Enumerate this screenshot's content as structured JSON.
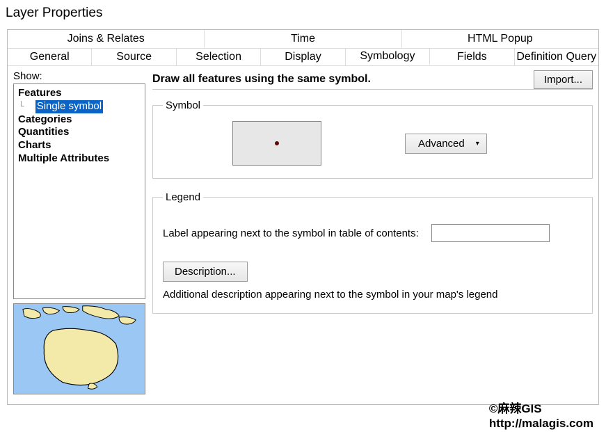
{
  "window": {
    "title": "Layer Properties"
  },
  "tabs": {
    "row1": [
      {
        "label": "Joins & Relates"
      },
      {
        "label": "Time"
      },
      {
        "label": "HTML Popup"
      }
    ],
    "row2": [
      {
        "label": "General"
      },
      {
        "label": "Source"
      },
      {
        "label": "Selection"
      },
      {
        "label": "Display"
      },
      {
        "label": "Symbology",
        "active": true
      },
      {
        "label": "Fields"
      },
      {
        "label": "Definition Query"
      }
    ]
  },
  "show": {
    "label": "Show:",
    "items": {
      "features": "Features",
      "single_symbol": "Single symbol",
      "categories": "Categories",
      "quantities": "Quantities",
      "charts": "Charts",
      "multiple_attributes": "Multiple Attributes"
    }
  },
  "heading": "Draw all features using the same symbol.",
  "import_btn": "Import...",
  "symbol_group": {
    "legend": "Symbol",
    "advanced": "Advanced"
  },
  "legend_group": {
    "legend": "Legend",
    "label_text": "Label appearing next to the symbol in table of contents:",
    "label_value": "",
    "desc_btn": "Description...",
    "desc_text": "Additional description appearing next to the symbol in your map's legend"
  },
  "watermark": {
    "line1": "©麻辣GIS",
    "line2": "http://malagis.com"
  }
}
